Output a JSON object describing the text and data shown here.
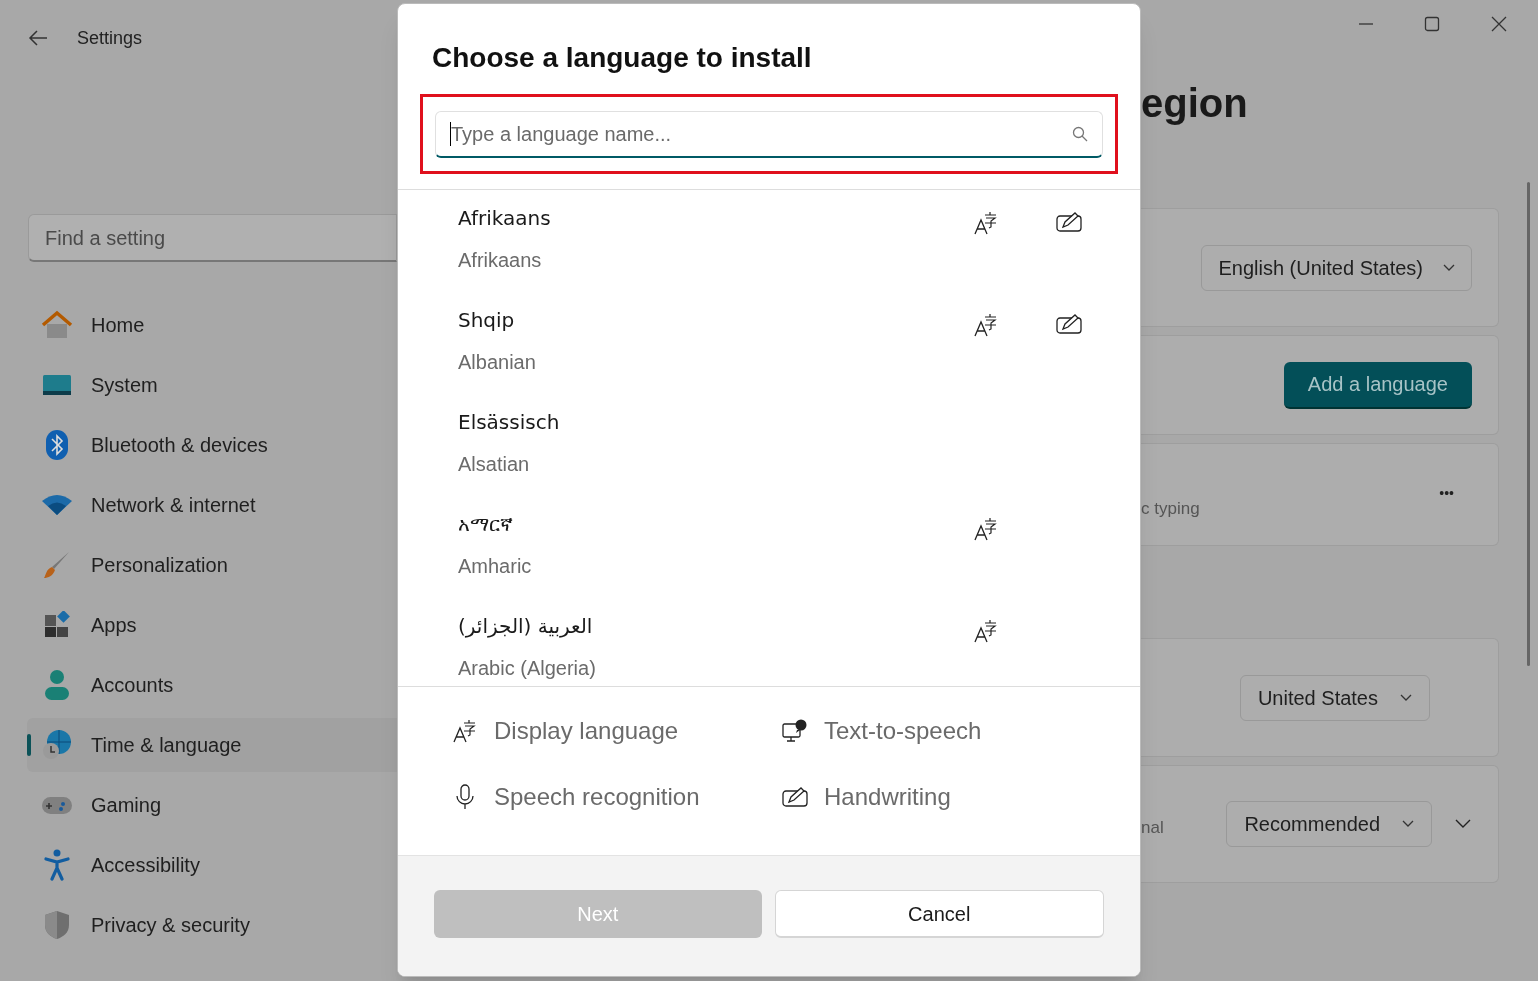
{
  "window": {
    "title": "Settings"
  },
  "sidebar": {
    "search": {
      "placeholder": "Find a setting"
    },
    "items": [
      {
        "label": "Home",
        "selected": false
      },
      {
        "label": "System",
        "selected": false
      },
      {
        "label": "Bluetooth & devices",
        "selected": false
      },
      {
        "label": "Network & internet",
        "selected": false
      },
      {
        "label": "Personalization",
        "selected": false
      },
      {
        "label": "Apps",
        "selected": false
      },
      {
        "label": "Accounts",
        "selected": false
      },
      {
        "label": "Time & language",
        "selected": true
      },
      {
        "label": "Gaming",
        "selected": false
      },
      {
        "label": "Accessibility",
        "selected": false
      },
      {
        "label": "Privacy & security",
        "selected": false
      }
    ]
  },
  "page": {
    "title_fragment": "egion",
    "windows_display_language": "English (United States)",
    "add_language_button": "Add a language",
    "typing_fragment": "c typing",
    "more_button": "•••",
    "country_dropdown": "United States",
    "regional_fragment": "nal",
    "regional_format_dropdown": "Recommended"
  },
  "dialog": {
    "title": "Choose a language to install",
    "search": {
      "placeholder": "Type a language name...",
      "highlighted": true
    },
    "languages": [
      {
        "name": "Afrikaans",
        "english": "Afrikaans",
        "display": true,
        "handwriting": true
      },
      {
        "name": "Shqip",
        "english": "Albanian",
        "display": true,
        "handwriting": true
      },
      {
        "name": "Elsässisch",
        "english": "Alsatian",
        "display": false,
        "handwriting": false
      },
      {
        "name": "አማርኛ",
        "english": "Amharic",
        "display": true,
        "handwriting": false
      },
      {
        "name": "العربية (الجزائر)",
        "english": "Arabic (Algeria)",
        "display": true,
        "handwriting": false
      }
    ],
    "legend": [
      {
        "kind": "display",
        "label": "Display language"
      },
      {
        "kind": "tts",
        "label": "Text-to-speech"
      },
      {
        "kind": "speech",
        "label": "Speech recognition"
      },
      {
        "kind": "handwriting",
        "label": "Handwriting"
      }
    ],
    "buttons": [
      {
        "label": "Next",
        "disabled": true
      },
      {
        "label": "Cancel",
        "disabled": false
      }
    ]
  }
}
